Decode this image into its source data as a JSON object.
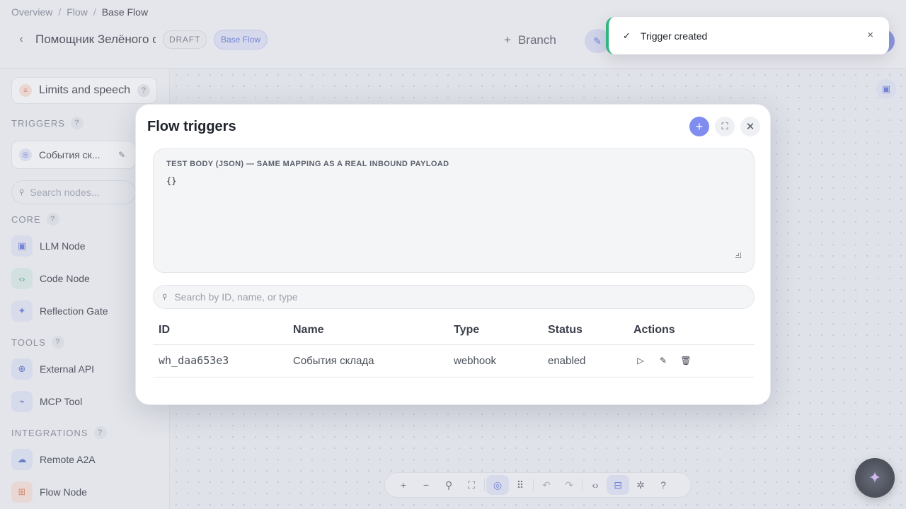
{
  "breadcrumb": {
    "items": [
      "Overview",
      "Flow",
      "Base Flow"
    ]
  },
  "header": {
    "flow_name": "Помощник Зелёного сс",
    "draft_badge": "DRAFT",
    "base_flow_badge": "Base Flow",
    "branch_label": "Branch"
  },
  "sidebar": {
    "limits_label": "Limits and speech",
    "help": "?",
    "sections": {
      "triggers": "TRIGGERS",
      "core": "CORE",
      "tools": "TOOLS",
      "integrations": "INTEGRATIONS"
    },
    "trigger_item": "События ск...",
    "search_placeholder": "Search nodes...",
    "core_nodes": [
      "LLM Node",
      "Code Node",
      "Reflection Gate"
    ],
    "tool_nodes": [
      "External API",
      "MCP Tool"
    ],
    "integration_nodes": [
      "Remote A2A",
      "Flow Node"
    ]
  },
  "modal": {
    "title": "Flow triggers",
    "test_body_label": "TEST BODY (JSON) — SAME MAPPING AS A REAL INBOUND PAYLOAD",
    "test_body_value": "{}",
    "search_placeholder": "Search by ID, name, or type",
    "columns": [
      "ID",
      "Name",
      "Type",
      "Status",
      "Actions"
    ],
    "rows": [
      {
        "id": "wh_daa653e3",
        "name": "События склада",
        "type": "webhook",
        "status": "enabled"
      }
    ]
  },
  "toast": {
    "message": "Trigger created"
  },
  "colors": {
    "accent": "#7f8cf0",
    "success": "#2eb67d"
  }
}
